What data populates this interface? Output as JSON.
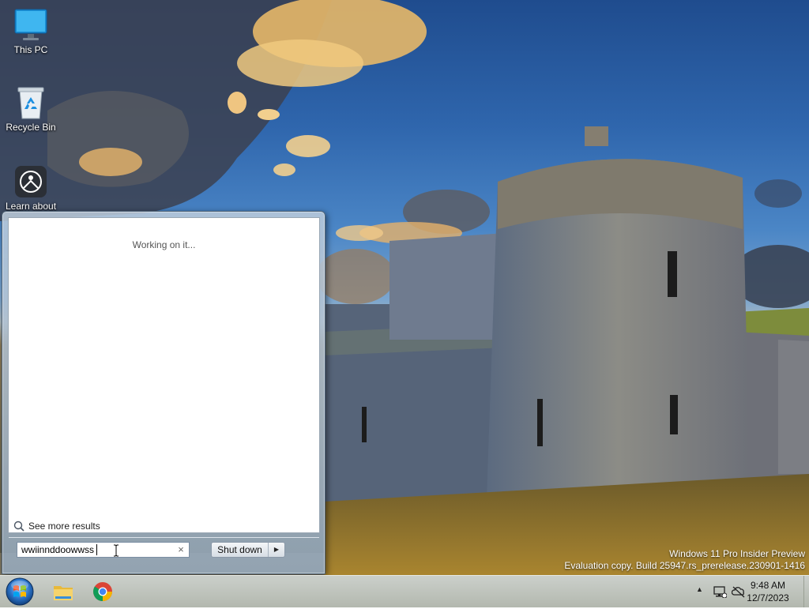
{
  "desktop": {
    "icons": [
      {
        "label": "This PC",
        "icon": "monitor-icon"
      },
      {
        "label": "Recycle Bin",
        "icon": "recycle-bin-icon"
      },
      {
        "label": "Learn about",
        "icon": "learn-about-icon"
      }
    ]
  },
  "start_menu": {
    "status_text": "Working on it...",
    "see_more_label": "See more results",
    "search": {
      "value": "wwiinnddoowwss",
      "placeholder": "",
      "clear_symbol": "×"
    },
    "shutdown_label": "Shut down",
    "shutdown_arrow": "▶"
  },
  "watermark": {
    "line1": "Windows 11 Pro Insider Preview",
    "line2": "Evaluation copy. Build 25947.rs_prerelease.230901-1416"
  },
  "taskbar": {
    "pinned": [
      "file-explorer-icon",
      "chrome-icon"
    ],
    "tray": {
      "overflow_symbol": "▲",
      "time": "9:48 AM",
      "date": "12/7/2023"
    }
  },
  "colors": {
    "sky": "#2f66ad",
    "accent_blue": "#1e6bd0"
  }
}
